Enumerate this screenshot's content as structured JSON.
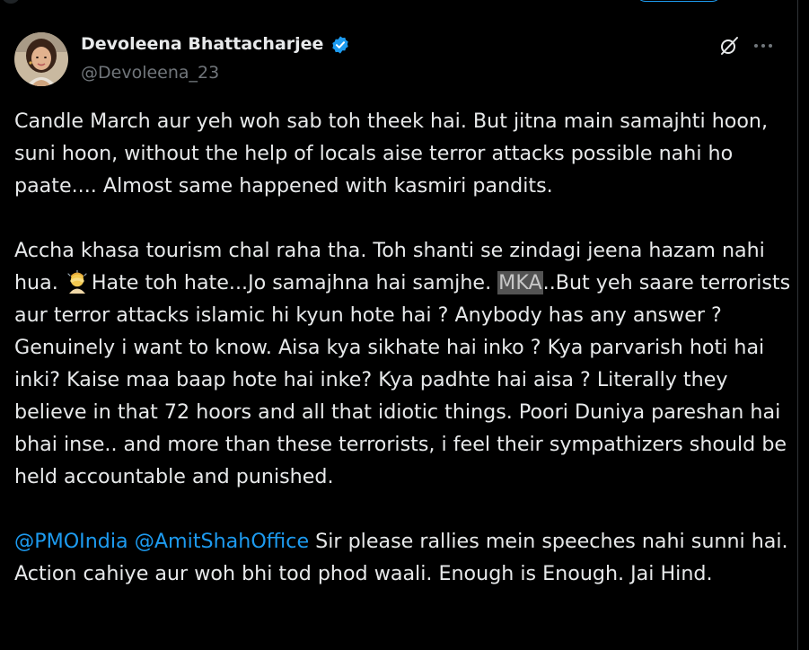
{
  "author": {
    "display_name": "Devoleena Bhattacharjee",
    "handle": "@Devoleena_23",
    "verified": true
  },
  "icons": {
    "avatar": "profile-photo",
    "verified": "verified-badge-icon",
    "grok": "grok-icon",
    "more": "more-options-icon",
    "emoji": "person-facepalming-emoji"
  },
  "colors": {
    "background": "#000000",
    "text": "#e7e9ea",
    "secondary": "#71767b",
    "accent": "#1d9bf0"
  },
  "tweet": {
    "p1": "Candle March aur yeh woh sab toh theek hai. But jitna main samajhti hoon, suni hoon, without the help of locals aise terror attacks possible nahi ho paate.... Almost same happened with kasmiri pandits.",
    "p2_a": "Accha khasa tourism chal raha tha. Toh shanti se zindagi jeena hazam nahi hua. ",
    "p2_b": "Hate toh hate...Jo samajhna hai samjhe. ",
    "p2_redacted": "MKA",
    "p2_c": "..But yeh saare terrorists aur terror attacks islamic hi kyun hote hai  ? Anybody has any answer ? Genuinely i want to know. Aisa kya sikhate hai inko ? Kya parvarish hoti hai inki? Kaise maa baap hote hai inke? Kya padhte hai aisa ? Literally they believe in that  72 hoors and all that idiotic things. Poori Duniya pareshan hai bhai inse.. and more than these terrorists, i feel their sympathizers should be held accountable and punished.",
    "mention_1": "@PMOIndia",
    "mention_2": "@AmitShahOffice",
    "p3": " Sir please rallies mein speeches nahi sunni hai. Action cahiye aur woh bhi tod phod waali. Enough is Enough. Jai Hind."
  }
}
